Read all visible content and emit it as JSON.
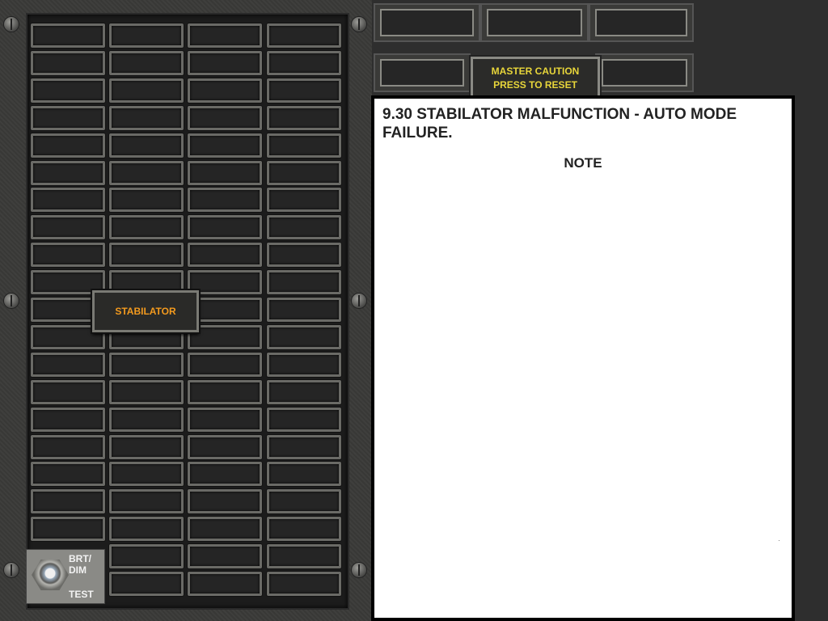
{
  "caution_panel": {
    "stabilator_label": "STABILATOR",
    "switch": {
      "brt_dim_label": "BRT/\nDIM",
      "test_label": "TEST"
    }
  },
  "master_caution": {
    "line1": "MASTER CAUTION",
    "line2": "PRESS TO RESET"
  },
  "procedure": {
    "title": "9.30  STABILATOR MALFUNCTION - AUTO MODE FAILURE.",
    "note": "NOTE"
  },
  "colors": {
    "stabilator_amber": "#f39a1e",
    "master_caution_yellow": "#e8d63a"
  }
}
